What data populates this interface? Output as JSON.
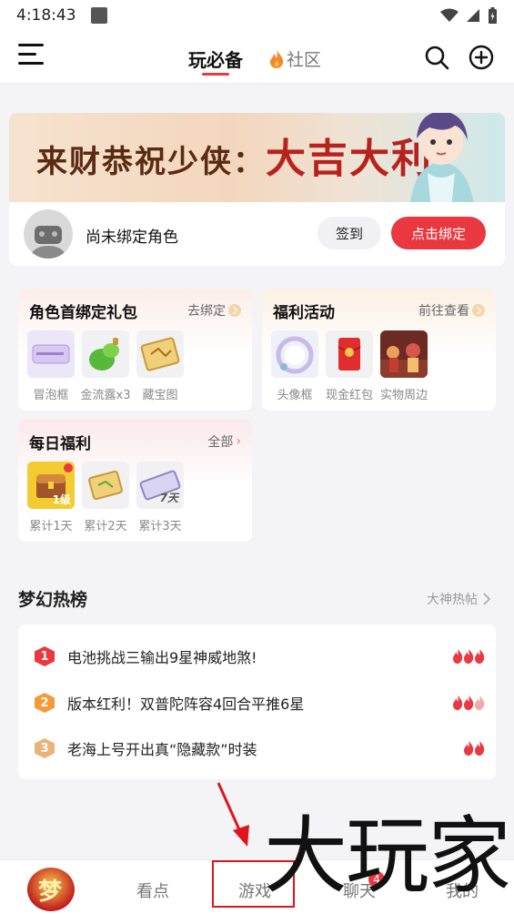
{
  "status": {
    "time": "4:18:43"
  },
  "nav": {
    "tab_main": "玩必备",
    "tab_community": "社区"
  },
  "banner": {
    "title_part1": "来财恭祝少侠：",
    "title_part2": "大吉大利"
  },
  "bind": {
    "label": "尚未绑定角色",
    "sign_label": "签到",
    "bind_label": "点击绑定"
  },
  "cards": {
    "first_bind": {
      "title": "角色首绑定礼包",
      "link": "去绑定",
      "items": [
        {
          "label": "冒泡框"
        },
        {
          "label": "金流露x3"
        },
        {
          "label": "藏宝图"
        }
      ]
    },
    "welfare": {
      "title": "福利活动",
      "link": "前往查看",
      "items": [
        {
          "label": "头像框"
        },
        {
          "label": "现金红包"
        },
        {
          "label": "实物周边"
        }
      ]
    },
    "daily": {
      "title": "每日福利",
      "link": "全部",
      "items": [
        {
          "label": "累计1天",
          "tag": "1级"
        },
        {
          "label": "累计2天"
        },
        {
          "label": "累计3天",
          "tag": "7天"
        }
      ]
    }
  },
  "hot": {
    "title": "梦幻热榜",
    "link": "大神热帖",
    "items": [
      {
        "rank": "1",
        "text": "电池挑战三输出9星神威地煞!",
        "heat": 3,
        "color": "#e9383f"
      },
      {
        "rank": "2",
        "text": "版本红利！双普陀阵容4回合平推6星",
        "heat": 2.5,
        "color": "#f29a38"
      },
      {
        "rank": "3",
        "text": "老海上号开出真“隐藏款”时装",
        "heat": 2,
        "color": "#e8b47a"
      }
    ]
  },
  "bottom": {
    "logo_text": "梦",
    "tabs": [
      "看点",
      "游戏",
      "聊天",
      "我的"
    ],
    "badge": "4"
  },
  "watermark": "大玩家",
  "colors": {
    "accent": "#e9383f",
    "rank1": "#e9383f",
    "rank2": "#f29a38",
    "rank3": "#e8b47a"
  }
}
